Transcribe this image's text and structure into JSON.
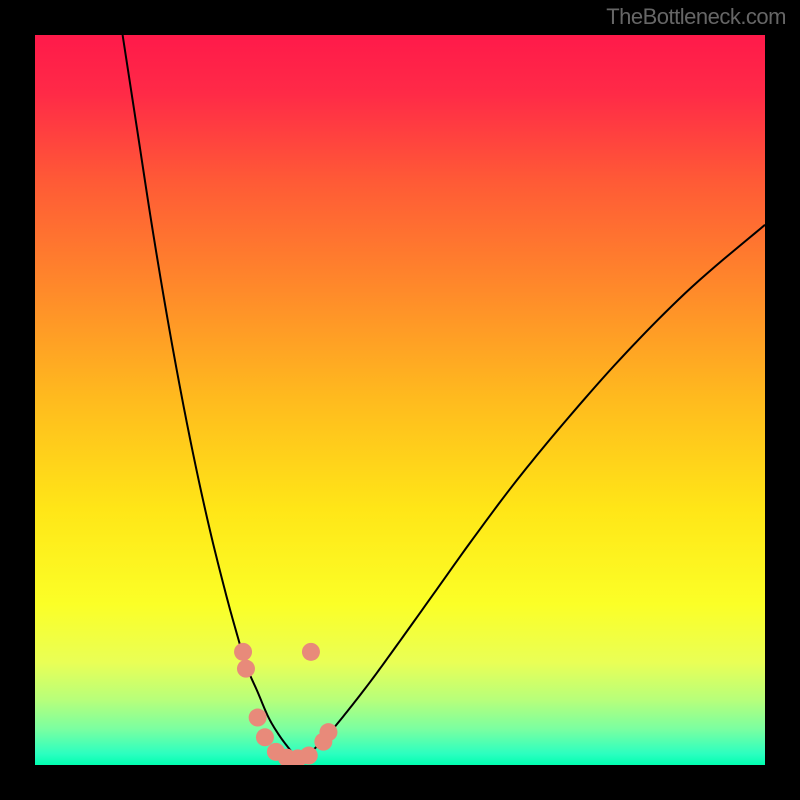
{
  "watermark": "TheBottleneck.com",
  "chart_data": {
    "type": "line",
    "title": "",
    "xlabel": "",
    "ylabel": "",
    "xlim": [
      0,
      100
    ],
    "ylim": [
      0,
      100
    ],
    "background": {
      "type": "vertical-gradient",
      "stops": [
        {
          "offset": 0.0,
          "color": "#ff1a4a"
        },
        {
          "offset": 0.08,
          "color": "#ff2a47"
        },
        {
          "offset": 0.2,
          "color": "#ff5a36"
        },
        {
          "offset": 0.35,
          "color": "#ff8a2a"
        },
        {
          "offset": 0.5,
          "color": "#ffbb1e"
        },
        {
          "offset": 0.65,
          "color": "#ffe617"
        },
        {
          "offset": 0.78,
          "color": "#fbff27"
        },
        {
          "offset": 0.86,
          "color": "#e9ff56"
        },
        {
          "offset": 0.91,
          "color": "#b8ff7a"
        },
        {
          "offset": 0.95,
          "color": "#7cffa0"
        },
        {
          "offset": 0.985,
          "color": "#2bffc0"
        },
        {
          "offset": 1.0,
          "color": "#00ffb0"
        }
      ]
    },
    "series": [
      {
        "name": "left-curve",
        "x": [
          12.0,
          14.0,
          16.0,
          18.0,
          20.0,
          22.0,
          24.0,
          26.0,
          27.5,
          29.0,
          30.5,
          32.0,
          33.5,
          35.0,
          36.0
        ],
        "y": [
          100.0,
          87.0,
          74.0,
          62.0,
          51.0,
          41.0,
          32.0,
          24.0,
          18.5,
          13.5,
          10.0,
          6.5,
          4.0,
          2.0,
          0.8
        ],
        "color": "#000000",
        "width": 2
      },
      {
        "name": "right-curve",
        "x": [
          36.0,
          38.0,
          40.0,
          42.5,
          46.0,
          50.0,
          55.0,
          60.0,
          66.0,
          73.0,
          81.0,
          90.0,
          100.0
        ],
        "y": [
          0.8,
          2.0,
          4.0,
          7.0,
          11.5,
          17.0,
          24.0,
          31.0,
          39.0,
          47.5,
          56.5,
          65.5,
          74.0
        ],
        "color": "#000000",
        "width": 2
      }
    ],
    "markers": {
      "color": "#e88a7a",
      "radius": 9,
      "points": [
        {
          "x": 28.5,
          "y": 15.5
        },
        {
          "x": 28.9,
          "y": 13.2
        },
        {
          "x": 30.5,
          "y": 6.5
        },
        {
          "x": 31.5,
          "y": 3.8
        },
        {
          "x": 33.0,
          "y": 1.8
        },
        {
          "x": 34.5,
          "y": 1.0
        },
        {
          "x": 36.0,
          "y": 0.9
        },
        {
          "x": 37.5,
          "y": 1.3
        },
        {
          "x": 39.5,
          "y": 3.2
        },
        {
          "x": 40.2,
          "y": 4.5
        },
        {
          "x": 37.8,
          "y": 15.5
        }
      ]
    }
  }
}
